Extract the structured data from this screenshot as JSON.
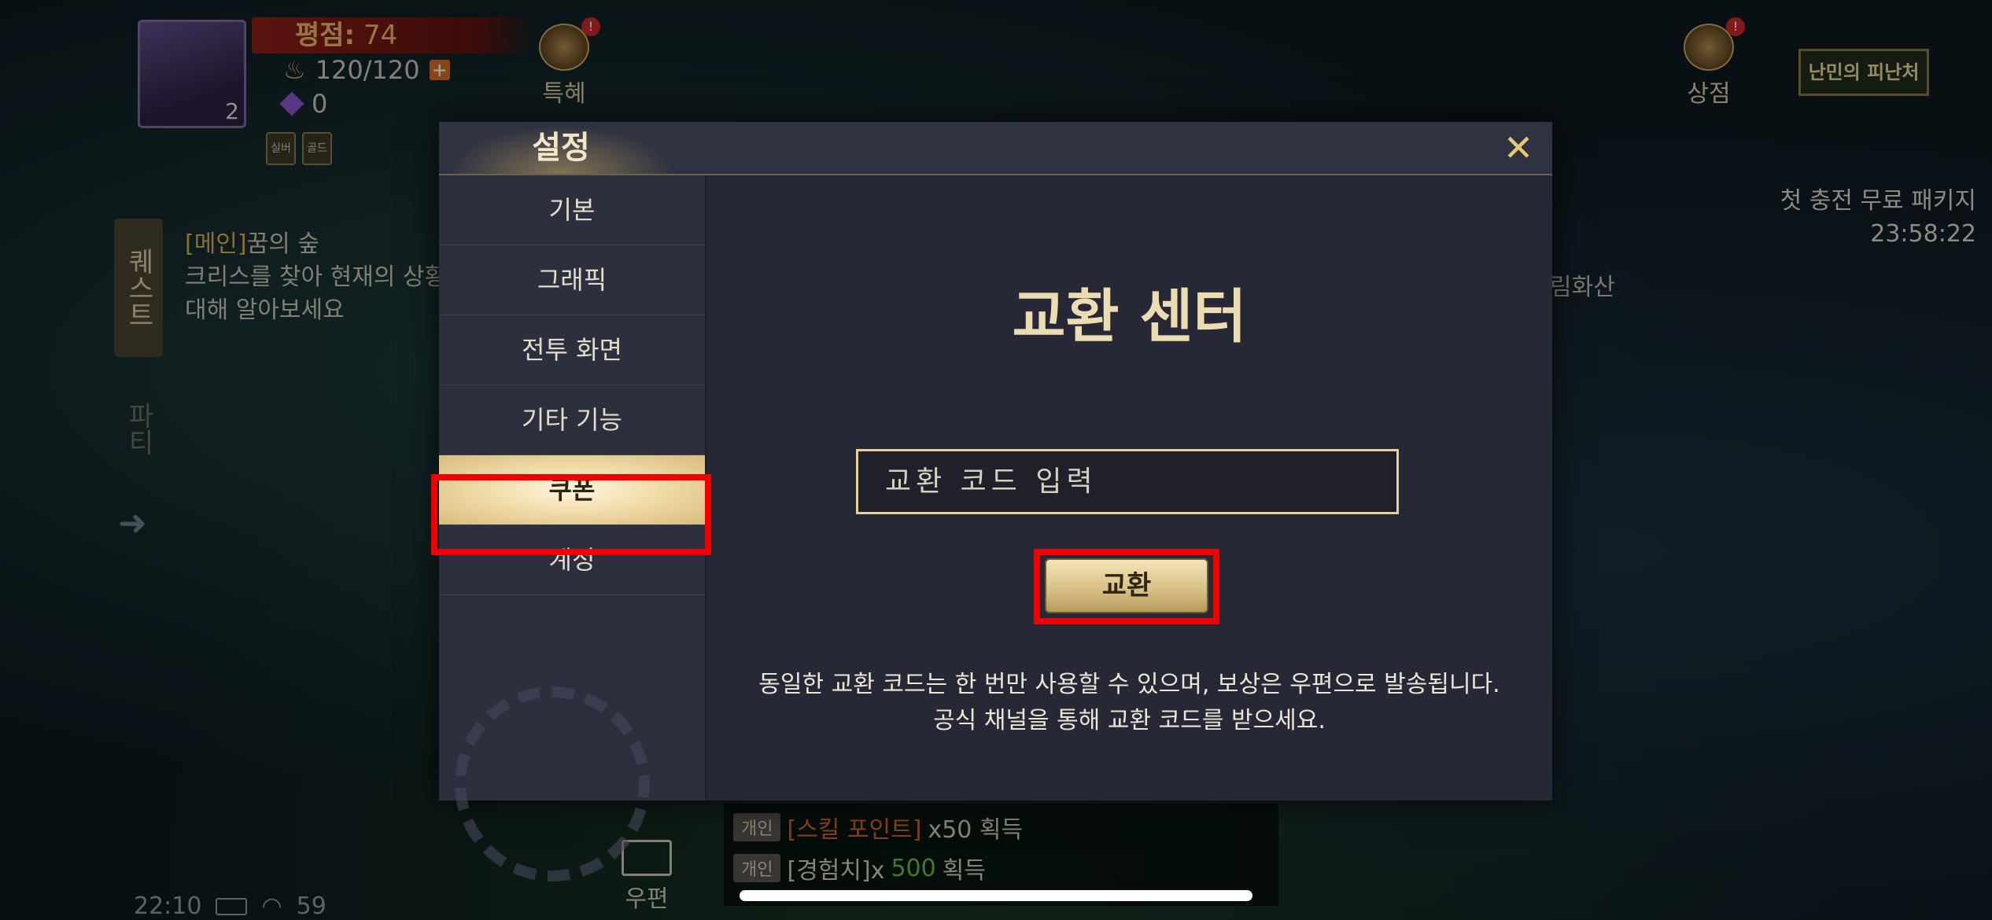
{
  "hud": {
    "rating_label": "평점:",
    "rating_value": "74",
    "portrait_level": "2",
    "stamina": "120/120",
    "stamina_plus": "+",
    "gems": "0",
    "tag1": "실버",
    "tag2": "골드",
    "benefit_label": "특혜",
    "shop_label": "상점",
    "refuge_label": "난민의 피난처",
    "first_pack_label": "첫 충전 무료 패키지",
    "first_pack_timer": "23:58:22",
    "quest_tab": "퀘스트",
    "party_tab": "파티",
    "quest_main_tag": "[메인]",
    "quest_title": "꿈의 숲",
    "quest_desc_line1": "크리스를 찾아 현재의 상황",
    "quest_desc_line2": "대해 알아보세요",
    "side_location": "림화산",
    "mail_label": "우편",
    "clock": "22:10",
    "battery": "59"
  },
  "chat": [
    {
      "tag": "개인",
      "hl": "[스킬 포인트]",
      "rest_pre": "x50 획득",
      "num": "",
      "rest_post": ""
    },
    {
      "tag": "개인",
      "hl": "",
      "rest_pre": "[경험치]x",
      "num": "500",
      "rest_post": " 획득"
    }
  ],
  "modal": {
    "title": "설정",
    "close_symbol": "✕",
    "menu": [
      "기본",
      "그래픽",
      "전투 화면",
      "기타 기능",
      "쿠폰",
      "계정"
    ],
    "active_menu": "쿠폰",
    "content_title": "교환 센터",
    "input_placeholder": "교환 코드 입력",
    "input_value": "",
    "exchange_button": "교환",
    "note_line1": "동일한 교환 코드는 한 번만 사용할 수 있으며, 보상은 우편으로 발송됩니다.",
    "note_line2": "공식 채널을 통해 교환 코드를 받으세요."
  },
  "colors": {
    "accent_gold": "#e6d19b",
    "highlight_red": "#f00000",
    "panel_bg": "#262835"
  }
}
